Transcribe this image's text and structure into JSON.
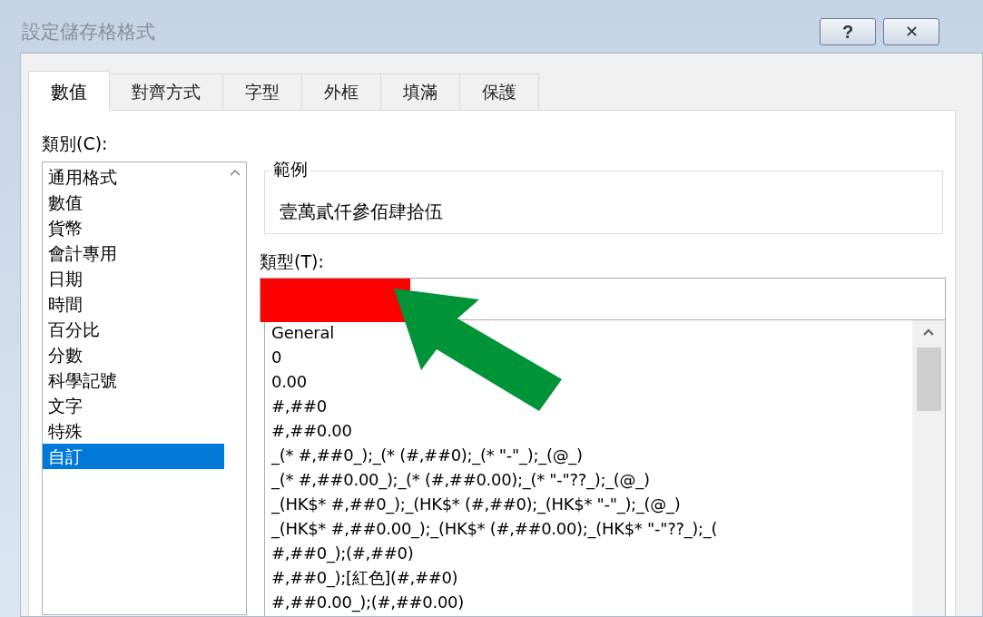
{
  "window": {
    "title": "設定儲存格格式",
    "buttons": [
      {
        "kind": "help",
        "label": "?"
      },
      {
        "kind": "close",
        "label": "✕"
      }
    ]
  },
  "tabs": [
    {
      "label": "數值",
      "selected": true
    },
    {
      "label": "對齊方式",
      "selected": false
    },
    {
      "label": "字型",
      "selected": false
    },
    {
      "label": "外框",
      "selected": false
    },
    {
      "label": "填滿",
      "selected": false
    },
    {
      "label": "保護",
      "selected": false
    }
  ],
  "category": {
    "label": "類別(C):",
    "items": [
      {
        "label": "通用格式",
        "selected": false
      },
      {
        "label": "數值",
        "selected": false
      },
      {
        "label": "貨幣",
        "selected": false
      },
      {
        "label": "會計專用",
        "selected": false
      },
      {
        "label": "日期",
        "selected": false
      },
      {
        "label": "時間",
        "selected": false
      },
      {
        "label": "百分比",
        "selected": false
      },
      {
        "label": "分數",
        "selected": false
      },
      {
        "label": "科學記號",
        "selected": false
      },
      {
        "label": "文字",
        "selected": false
      },
      {
        "label": "特殊",
        "selected": false
      },
      {
        "label": "自訂",
        "selected": true
      }
    ]
  },
  "sample": {
    "label": "範例",
    "value": "壹萬貳仟參佰肆拾伍"
  },
  "type": {
    "label": "類型(T):",
    "redacted": true,
    "items": [
      "General",
      "0",
      "0.00",
      "#,##0",
      "#,##0.00",
      "_(* #,##0_);_(* (#,##0);_(* \"-\"_);_(@_)",
      "_(* #,##0.00_);_(* (#,##0.00);_(* \"-\"??_);_(@_)",
      "_(HK$* #,##0_);_(HK$* (#,##0);_(HK$* \"-\"_);_(@_)",
      "_(HK$* #,##0.00_);_(HK$* (#,##0.00);_(HK$* \"-\"??_);_(",
      "#,##0_);(#,##0)",
      "#,##0_);[紅色](#,##0)",
      "#,##0.00_);(#,##0.00)"
    ]
  },
  "annotation": {
    "kind": "arrow"
  }
}
